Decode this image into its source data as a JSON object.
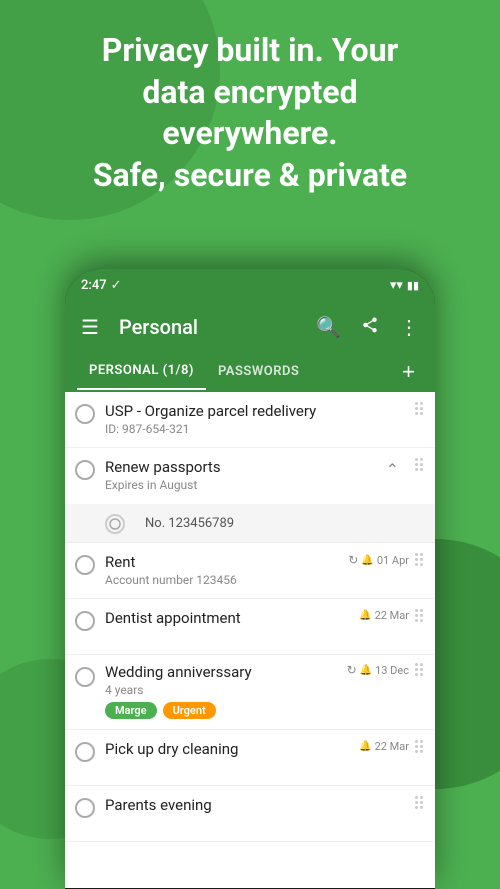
{
  "background": {
    "color": "#4caf50"
  },
  "header": {
    "line1": "Privacy built in. Your",
    "line2": "data encrypted",
    "line3": "everywhere.",
    "line4": "Safe, secure & private"
  },
  "status_bar": {
    "time": "2:47",
    "check": "✓"
  },
  "toolbar": {
    "title": "Personal",
    "menu_icon": "☰",
    "search_icon": "🔍",
    "share_icon": "⎋",
    "more_icon": "⋮"
  },
  "tabs": [
    {
      "label": "PERSONAL (1/8)",
      "active": true
    },
    {
      "label": "PASSWORDS",
      "active": false
    }
  ],
  "tab_add_label": "+",
  "items": [
    {
      "id": "usp",
      "title": "USP - Organize parcel redelivery",
      "subtitle": "ID: 987-654-321",
      "has_date": false,
      "date": "",
      "has_repeat": false,
      "badges": []
    },
    {
      "id": "passports",
      "title": "Renew passports",
      "subtitle": "Expires in August",
      "has_date": false,
      "date": "",
      "has_repeat": false,
      "badges": [],
      "expanded": true,
      "sub_items": [
        {
          "label": "No. 123456789"
        }
      ]
    },
    {
      "id": "rent",
      "title": "Rent",
      "subtitle": "Account number 123456",
      "has_date": true,
      "date": "01 Apr",
      "has_repeat": true,
      "has_bell": true,
      "badges": []
    },
    {
      "id": "dentist",
      "title": "Dentist appointment",
      "subtitle": "",
      "has_date": true,
      "date": "22 Mar",
      "has_repeat": false,
      "has_bell": true,
      "badges": []
    },
    {
      "id": "wedding",
      "title": "Wedding anniverssary",
      "subtitle": "4 years",
      "has_date": true,
      "date": "13 Dec",
      "has_repeat": true,
      "has_bell": true,
      "badges": [
        "Marge",
        "Urgent"
      ]
    },
    {
      "id": "dry-cleaning",
      "title": "Pick up dry cleaning",
      "subtitle": "",
      "has_date": true,
      "date": "22 Mar",
      "has_repeat": false,
      "has_bell": true,
      "badges": []
    },
    {
      "id": "parents-evening",
      "title": "Parents evening",
      "subtitle": "",
      "has_date": false,
      "date": "",
      "has_repeat": false,
      "has_bell": false,
      "badges": []
    }
  ],
  "colors": {
    "green": "#388e3c",
    "light_green": "#4caf50",
    "orange": "#ff9800",
    "white": "#ffffff"
  }
}
